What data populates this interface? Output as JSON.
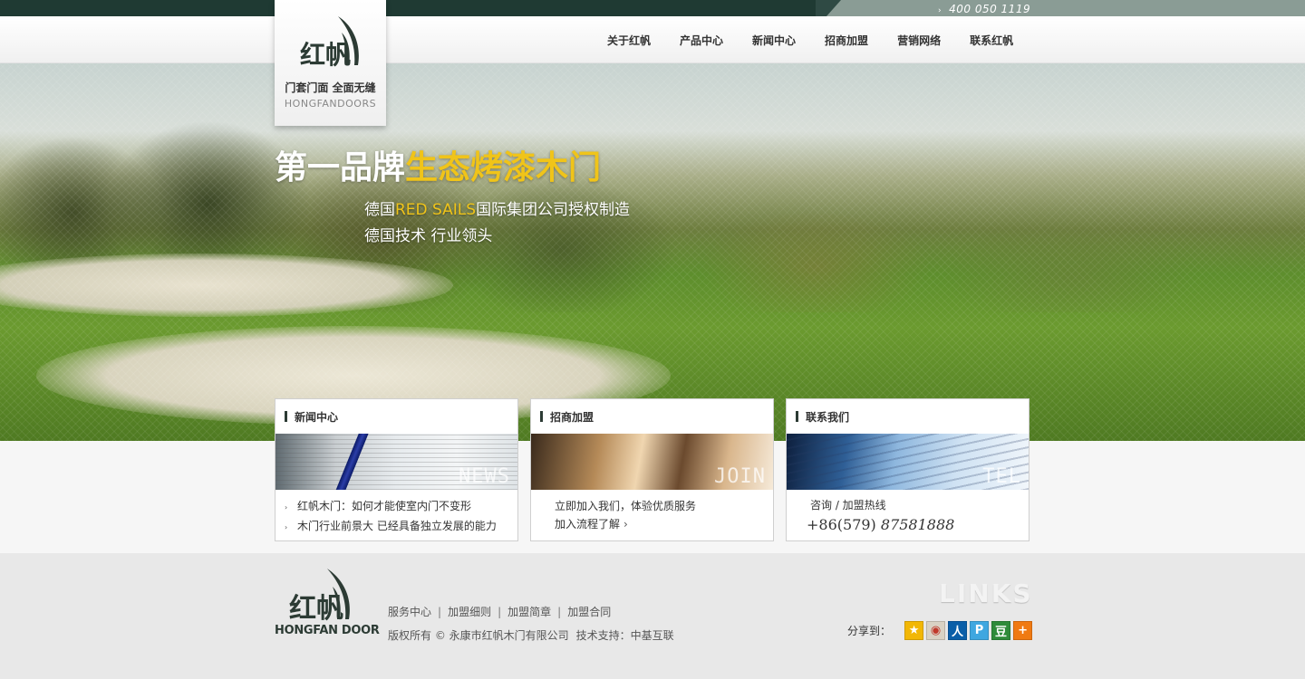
{
  "topbar": {
    "phone": "400 050 1119"
  },
  "logo": {
    "brand": "红帆",
    "slogan": "门套门面 全面无缝",
    "english": "HONGFANDOORS"
  },
  "nav": {
    "items": [
      {
        "label": "关于红帆"
      },
      {
        "label": "产品中心"
      },
      {
        "label": "新闻中心"
      },
      {
        "label": "招商加盟"
      },
      {
        "label": "营销网络"
      },
      {
        "label": "联系红帆"
      }
    ]
  },
  "banner": {
    "title_part1": "第一品牌",
    "title_part2": "生态烤漆木门",
    "sub1_part1": "德国",
    "sub1_highlight": "RED SAILS",
    "sub1_part2": "国际集团公司授权制造",
    "sub2": "德国技术 行业领头"
  },
  "cards": {
    "news": {
      "title": "新闻中心",
      "watermark": "NEWS",
      "items": [
        "红帆木门：如何才能使室内门不变形",
        "木门行业前景大 已经具备独立发展的能力"
      ]
    },
    "join": {
      "title": "招商加盟",
      "watermark": "JOIN",
      "line1": "立即加入我们，体验优质服务",
      "line2": "加入流程了解"
    },
    "contact": {
      "title": "联系我们",
      "watermark": "TEL",
      "label": "咨询 / 加盟热线",
      "number_prefix": "+86(579)",
      "number": "87581888"
    }
  },
  "footer": {
    "logo_brand": "红帆",
    "logo_english": "HONGFAN DOOR",
    "links": [
      "服务中心",
      "加盟细则",
      "加盟简章",
      "加盟合同"
    ],
    "copyright": "版权所有 © 永康市红帆木门有限公司",
    "support": "技术支持：中基互联",
    "links_title": "LINKS",
    "share_label": "分享到：",
    "share_icons": [
      {
        "name": "qzone-icon",
        "glyph": "★",
        "color": "#f2b705"
      },
      {
        "name": "weibo-icon",
        "glyph": "◉",
        "color": "#d9d2c4"
      },
      {
        "name": "renren-icon",
        "glyph": "人",
        "color": "#0a5ea8"
      },
      {
        "name": "kaixin-icon",
        "glyph": "P",
        "color": "#3fa7e0"
      },
      {
        "name": "douban-icon",
        "glyph": "豆",
        "color": "#2e8b3a"
      },
      {
        "name": "more-share-icon",
        "glyph": "+",
        "color": "#f07a12"
      }
    ]
  }
}
